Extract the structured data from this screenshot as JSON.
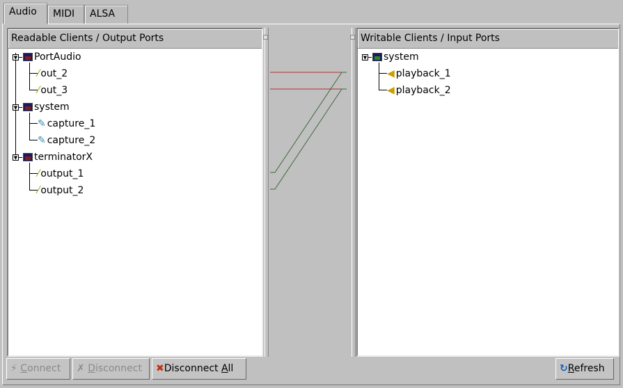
{
  "tabs": [
    {
      "label": "Audio",
      "active": true
    },
    {
      "label": "MIDI"
    },
    {
      "label": "ALSA"
    }
  ],
  "readable": {
    "header": "Readable Clients / Output Ports",
    "clients": [
      {
        "name": "PortAudio",
        "ports": [
          "out_2",
          "out_3"
        ]
      },
      {
        "name": "system",
        "ports": [
          "capture_1",
          "capture_2"
        ]
      },
      {
        "name": "terminatorX",
        "ports": [
          "output_1",
          "output_2"
        ]
      }
    ]
  },
  "writable": {
    "header": "Writable Clients / Input Ports",
    "clients": [
      {
        "name": "system",
        "ports": [
          "playback_1",
          "playback_2"
        ]
      }
    ]
  },
  "connections": [
    {
      "from": "PortAudio:out_2",
      "to": "system:playback_1",
      "color": "#b03030"
    },
    {
      "from": "PortAudio:out_3",
      "to": "system:playback_2",
      "color": "#b03030"
    },
    {
      "from": "terminatorX:output_1",
      "to": "system:playback_1",
      "color": "#3a6a3a"
    },
    {
      "from": "terminatorX:output_2",
      "to": "system:playback_2",
      "color": "#3a6a3a"
    }
  ],
  "buttons": {
    "connect": {
      "pre": "",
      "u": "C",
      "post": "onnect"
    },
    "disconnect": {
      "pre": "",
      "u": "D",
      "post": "isconnect"
    },
    "disconnect_all": {
      "pre": "Disconnect ",
      "u": "A",
      "post": "ll"
    },
    "refresh": {
      "pre": "",
      "u": "R",
      "post": "efresh"
    }
  }
}
